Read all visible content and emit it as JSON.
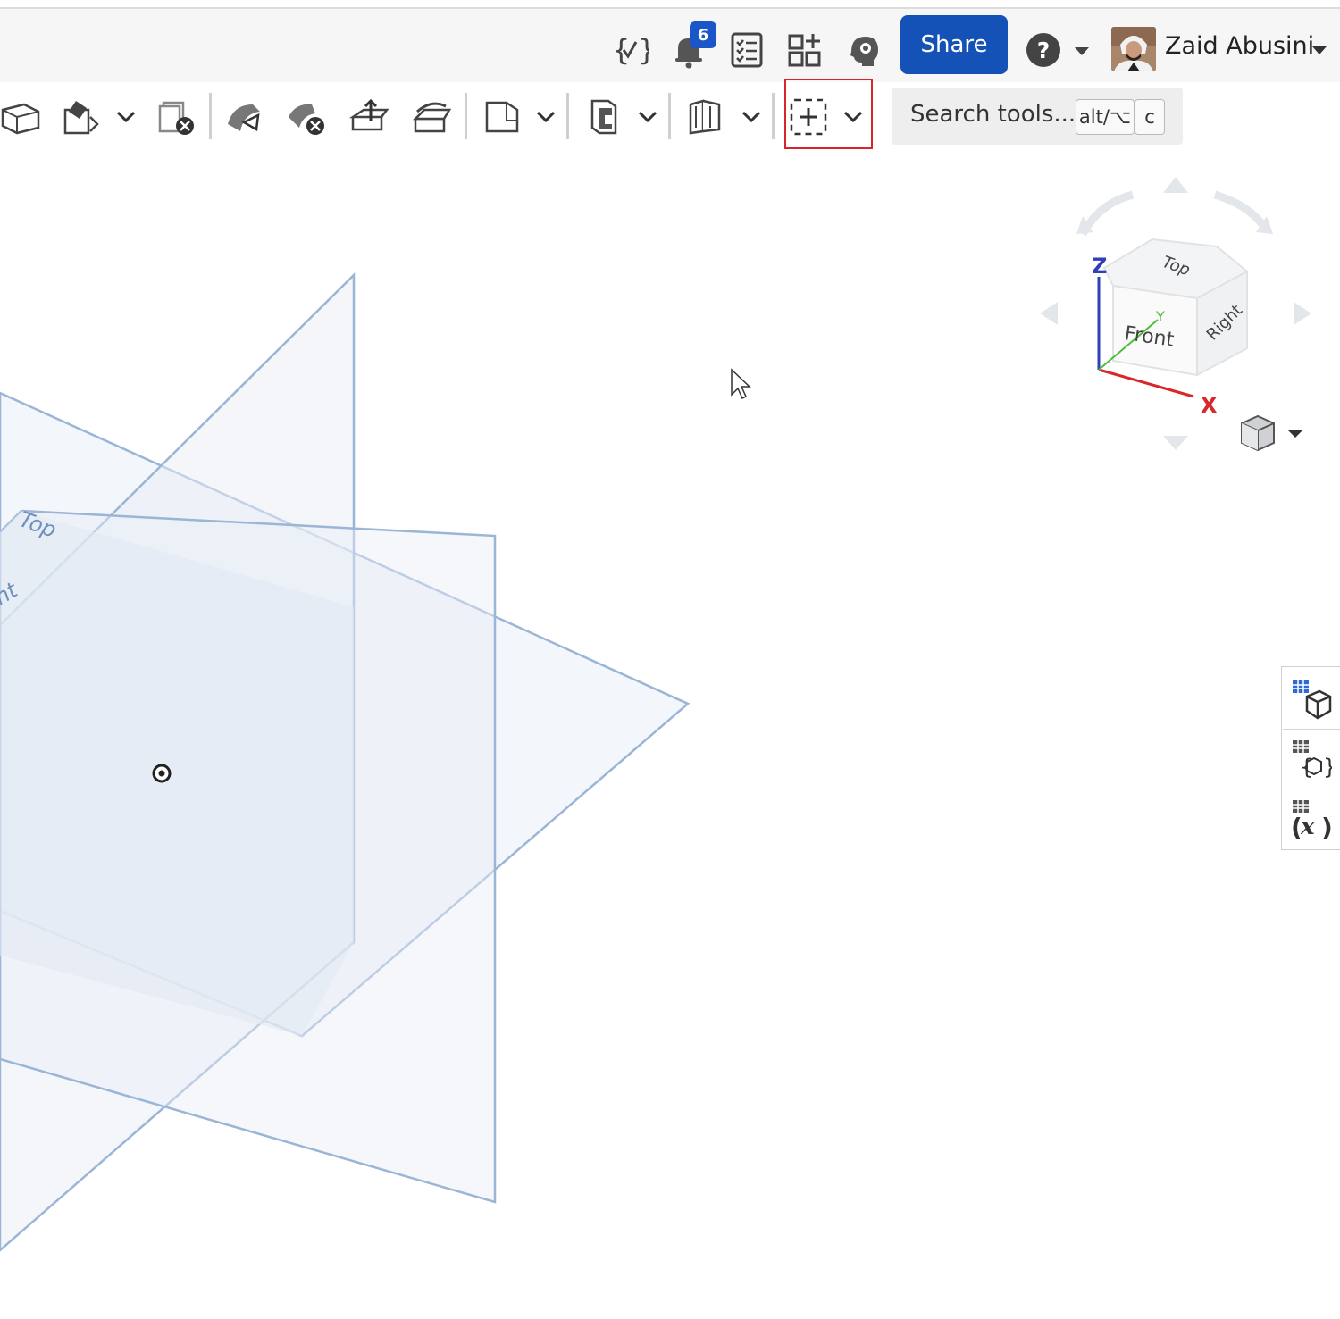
{
  "header": {
    "notification_count": "6",
    "share_label": "Share",
    "user_name": "Zaid Abusini"
  },
  "toolbar": {
    "search_placeholder": "Search tools...",
    "shortcut_modifier": "alt/⌥",
    "shortcut_key": "c"
  },
  "viewport": {
    "plane_labels": {
      "top": "Top",
      "right": "ht"
    },
    "view_cube": {
      "faces": {
        "top": "Top",
        "front": "Front",
        "right": "Right"
      },
      "axes": {
        "x": "X",
        "y": "Y",
        "z": "Z"
      }
    }
  },
  "colors": {
    "accent": "#1552b8",
    "highlight": "#d9232d",
    "plane_fill": "#e9eef6",
    "plane_edge": "#9ab5d6"
  }
}
